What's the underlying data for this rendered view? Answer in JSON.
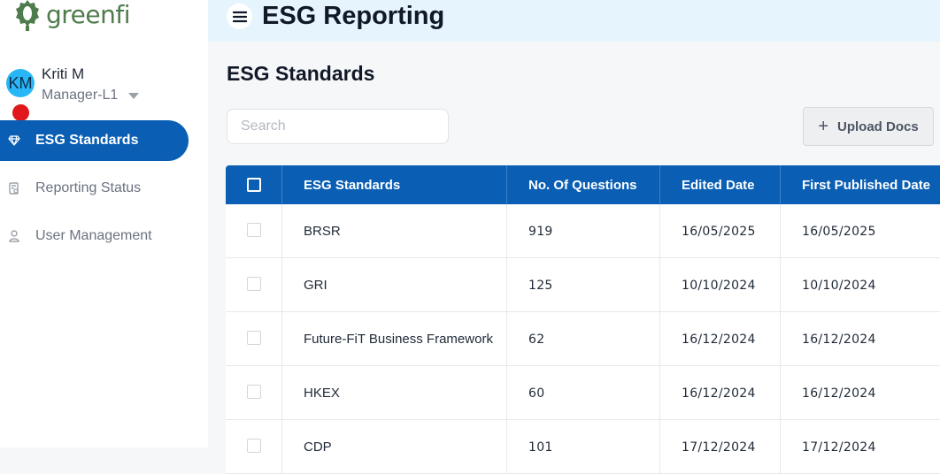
{
  "brand": {
    "logo_text": "greenfi",
    "logo_color": "#4f7c4c"
  },
  "user": {
    "initials": "KM",
    "name": "Kriti M",
    "role": "Manager-L1"
  },
  "sidebar": {
    "items": [
      {
        "label": "ESG Standards",
        "icon": "diamond-icon",
        "active": true
      },
      {
        "label": "Reporting Status",
        "icon": "report-icon",
        "active": false
      },
      {
        "label": "User Management",
        "icon": "user-icon",
        "active": false
      }
    ]
  },
  "header": {
    "title": "ESG Reporting"
  },
  "main": {
    "section_title": "ESG Standards",
    "search": {
      "placeholder": "Search",
      "value": ""
    },
    "upload_label": "Upload Docs"
  },
  "table": {
    "columns": [
      "ESG Standards",
      "No. Of Questions",
      "Edited Date",
      "First Published Date"
    ],
    "rows": [
      {
        "name": "BRSR",
        "questions": "919",
        "edited": "16/05/2025",
        "published": "16/05/2025"
      },
      {
        "name": "GRI",
        "questions": "125",
        "edited": "10/10/2024",
        "published": "10/10/2024"
      },
      {
        "name": "Future-FiT Business Framework",
        "questions": "62",
        "edited": "16/12/2024",
        "published": "16/12/2024"
      },
      {
        "name": "HKEX",
        "questions": "60",
        "edited": "16/12/2024",
        "published": "16/12/2024"
      },
      {
        "name": "CDP",
        "questions": "101",
        "edited": "17/12/2024",
        "published": "17/12/2024"
      }
    ]
  },
  "colors": {
    "primary": "#0a5fb4",
    "topbar": "#e6f5fd",
    "avatar": "#29b6f6",
    "notification": "#e0181b"
  }
}
